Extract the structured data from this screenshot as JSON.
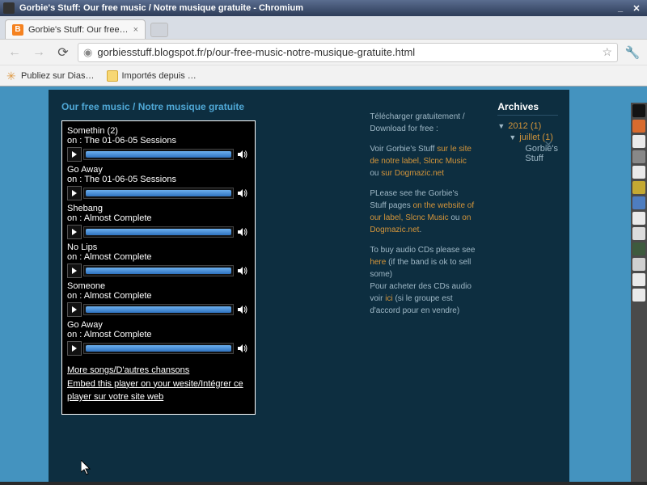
{
  "window": {
    "title": "Gorbie's Stuff: Our free music / Notre musique gratuite - Chromium"
  },
  "tab": {
    "title": "Gorbie's Stuff: Our free…",
    "favicon_letter": "B"
  },
  "url": "gorbiesstuff.blogspot.fr/p/our-free-music-notre-musique-gratuite.html",
  "bookmarks": [
    {
      "label": "Publiez sur Dias…"
    },
    {
      "label": "Importés depuis …"
    }
  ],
  "page": {
    "title": "Our free music / Notre musique gratuite",
    "tracks": [
      {
        "title": "Somethin (2)",
        "album": "on : The 01-06-05 Sessions"
      },
      {
        "title": "Go Away",
        "album": "on : The 01-06-05 Sessions"
      },
      {
        "title": "Shebang",
        "album": "on : Almost Complete"
      },
      {
        "title": "No Lips",
        "album": "on : Almost Complete"
      },
      {
        "title": "Someone",
        "album": "on : Almost Complete"
      },
      {
        "title": "Go Away",
        "album": "on : Almost Complete"
      }
    ],
    "more_songs": "More songs/D'autres chansons",
    "embed": "Embed this player on your wesite/Intégrer ce player sur votre site web"
  },
  "textcol": {
    "p1_a": "Télécharger gratuitement / Download for free :",
    "p2_pre": "Voir Gorbie's Stuff ",
    "p2_link1": "sur le site de notre label, Slcnc Music",
    "p2_mid": " ou ",
    "p2_link2": "sur Dogmazic.net",
    "p3_pre": "PLease see the Gorbie's Stuff pages ",
    "p3_link1": "on the website of our label, Slcnc Music",
    "p3_mid": " ou ",
    "p3_link2": "on Dogmazic.net",
    "p3_post": ".",
    "p4_pre": "To buy audio CDs please see ",
    "p4_link": "here",
    "p4_post": " (if the band is ok to sell some)",
    "p5_pre": "Pour acheter des CDs audio voir ",
    "p5_link": "ici",
    "p5_post": " (si le groupe est d'accord pour en vendre)"
  },
  "sidebar": {
    "heading": "Archives",
    "year": "2012 (1)",
    "month": "juillet (1)",
    "post": "Gorbie's Stuff"
  }
}
